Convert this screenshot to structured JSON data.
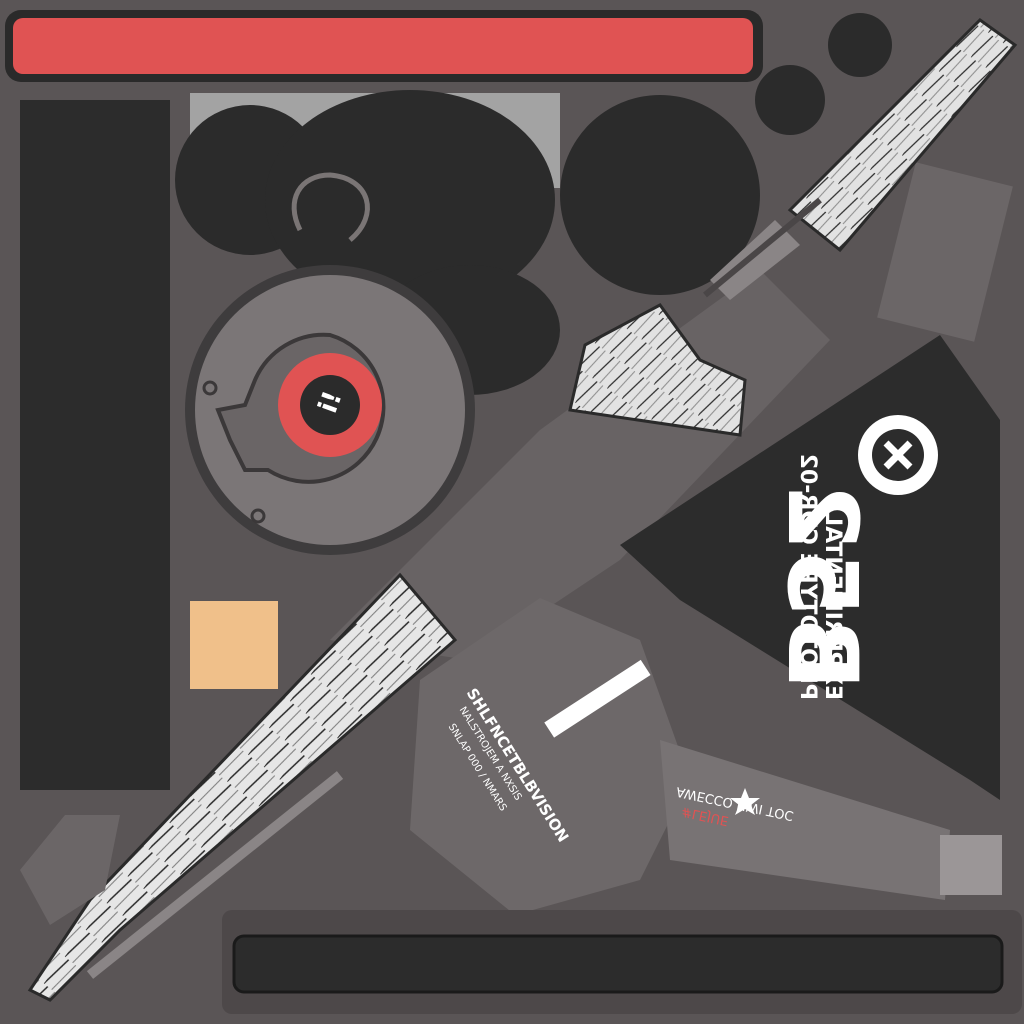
{
  "atlas": {
    "title": "",
    "background": "#5a5556",
    "colors": {
      "red_bar": "#e05353",
      "dark_panel": "#2c2c2c",
      "tan_swatch": "#f0c08a",
      "bandage": "#e8e8e8",
      "red_ring": "#e05353"
    }
  },
  "triangle_decal": {
    "line1": "PROTOTYPE CDR-02",
    "line2": "EXPERIMENTAL",
    "big": "B52",
    "badge_icon": "x-circle-icon"
  },
  "body_label": {
    "line1": "SHLFNCETBLBVISION",
    "line2": "NALSTROJEM A NXSIS",
    "line3": "SNLAP 000 / NMARS"
  },
  "grip_label": {
    "line1": "AWECCO NWI TOC",
    "line2": "#LEJUE",
    "star_icon": "star-icon"
  },
  "dial_label": "i!",
  "icons": [
    "hook-icon",
    "dial-icon",
    "star-icon",
    "x-circle-icon"
  ]
}
